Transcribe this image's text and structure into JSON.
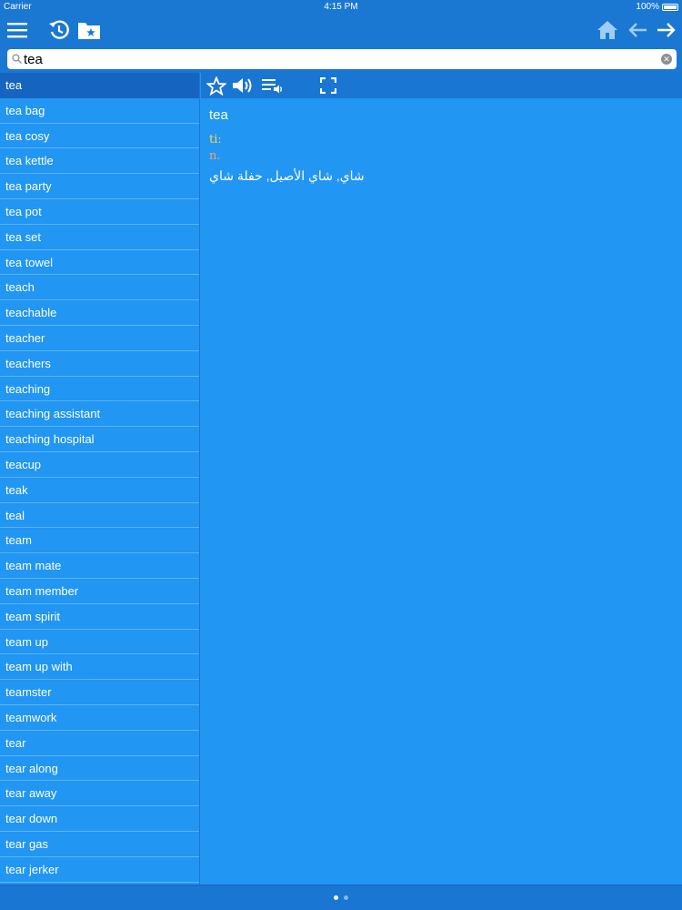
{
  "status": {
    "carrier": "Carrier",
    "time": "4:15 PM",
    "battery": "100%"
  },
  "toolbar": {
    "menu_icon": "hamburger-icon",
    "history_icon": "history-icon",
    "favorites_icon": "favorites-folder-icon",
    "home_icon": "home-icon",
    "back_icon": "arrow-left-icon",
    "forward_icon": "arrow-right-icon"
  },
  "search": {
    "value": "tea",
    "placeholder": ""
  },
  "wordlist": {
    "items": [
      "tea",
      "tea bag",
      "tea cosy",
      "tea kettle",
      "tea party",
      "tea pot",
      "tea set",
      "tea towel",
      "teach",
      "teachable",
      "teacher",
      "teachers",
      "teaching",
      "teaching assistant",
      "teaching hospital",
      "teacup",
      "teak",
      "teal",
      "team",
      "team mate",
      "team member",
      "team spirit",
      "team up",
      "team up with",
      "teamster",
      "teamwork",
      "tear",
      "tear along",
      "tear away",
      "tear down",
      "tear gas",
      "tear jerker"
    ],
    "selected_index": 0
  },
  "detail": {
    "word": "tea",
    "pronunciation": "tiː",
    "part_of_speech": "n.",
    "translation": "شاي, شاي الأصيل, حفلة شاي"
  },
  "colors": {
    "background": "#2196f3",
    "toolbar": "#1a78d2",
    "selected_row": "#1565c0",
    "pronunciation": "#ffd84d",
    "part_of_speech": "#ff9e7a"
  },
  "pager": {
    "pages": 2,
    "current": 1
  }
}
